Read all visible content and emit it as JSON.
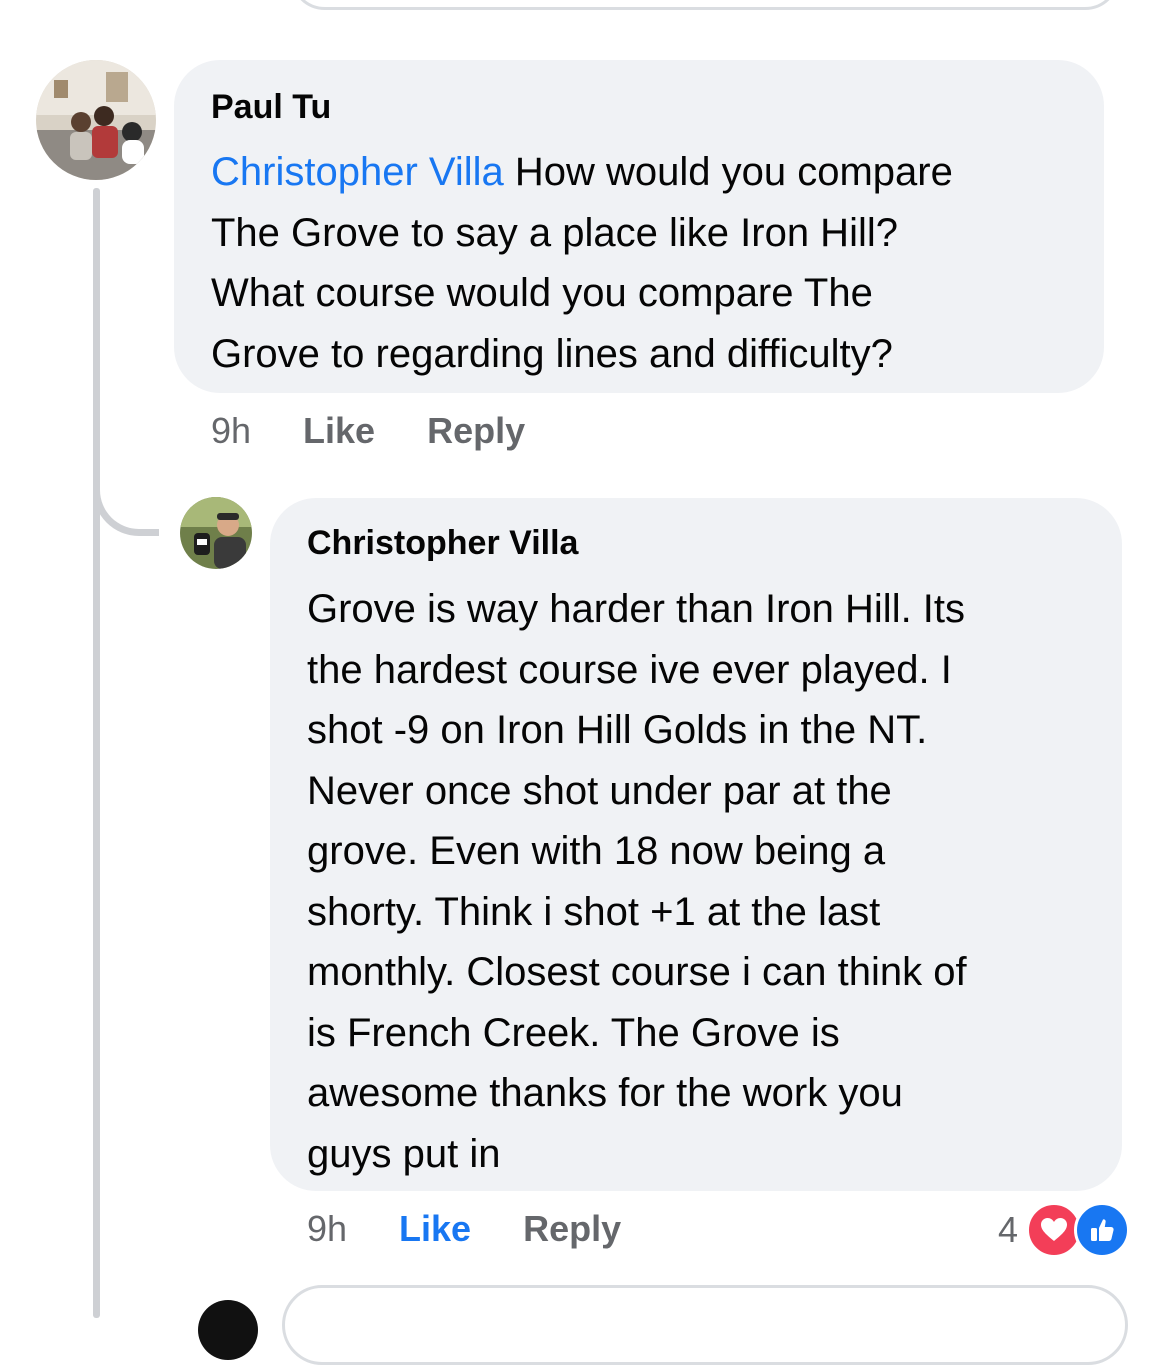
{
  "colors": {
    "bubble": "#f0f2f5",
    "mention": "#1877f2",
    "meta": "#65676b",
    "line": "#ced0d4",
    "liked": "#1877f2",
    "love": "#f33e58"
  },
  "comments": [
    {
      "author": "Paul Tu",
      "mention": "Christopher Villa",
      "text": " How would you compare\nThe Grove to say a place like Iron Hill?\nWhat course would you compare The\nGrove to regarding lines and difficulty?",
      "time": "9h",
      "like_label": "Like",
      "reply_label": "Reply",
      "avatar_icon": "profile-photo"
    },
    {
      "author": "Christopher Villa",
      "text": "Grove is way harder than Iron Hill.  Its\nthe hardest course ive ever played.  I\nshot -9 on Iron Hill Golds in the NT.\nNever once shot under par at the\ngrove.  Even with 18 now being a\nshorty.  Think i shot +1 at the last\nmonthly.  Closest course i can think of\nis French Creek.  The Grove is\nawesome thanks for the work you\nguys put in",
      "time": "9h",
      "like_label": "Like",
      "liked": true,
      "reply_label": "Reply",
      "reaction_count": "4",
      "reaction_icons": [
        "love-reaction-icon",
        "like-reaction-icon"
      ],
      "avatar_icon": "profile-photo"
    }
  ]
}
